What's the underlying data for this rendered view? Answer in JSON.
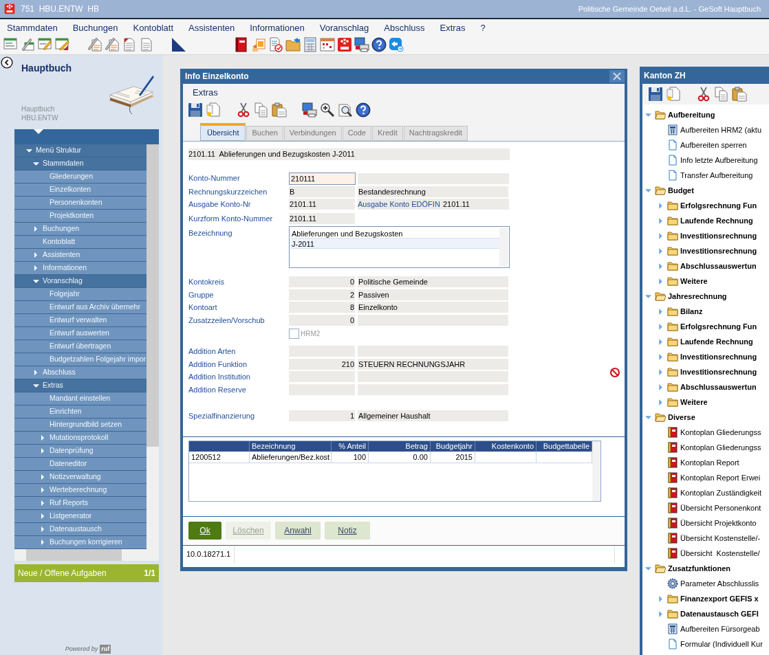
{
  "window": {
    "title": "751  HBU.ENTW  HB",
    "subtitle": "Politische Gemeinde Oetwil a.d.L. - GeSoft Hauptbuch"
  },
  "menu": [
    "Stammdaten",
    "Buchungen",
    "Kontoblatt",
    "Assistenten",
    "Informationen",
    "Voranschlag",
    "Abschluss",
    "Extras",
    "?"
  ],
  "sidebar": {
    "title": "Hauptbuch",
    "caption": [
      "Hauptbuch",
      "HBU.ENTW"
    ],
    "tree": [
      {
        "label": "Menü Struktur",
        "kind": "branch",
        "expanded": true,
        "children": [
          {
            "label": "Stammdaten",
            "kind": "branch",
            "expanded": true,
            "children": [
              {
                "label": "Gliederungen",
                "kind": "leaf"
              },
              {
                "label": "Einzelkonten",
                "kind": "leaf"
              },
              {
                "label": "Personenkonten",
                "kind": "leaf"
              },
              {
                "label": "Projektkonten",
                "kind": "leaf"
              }
            ]
          },
          {
            "label": "Buchungen",
            "kind": "branch",
            "expanded": false
          },
          {
            "label": "Kontoblatt",
            "kind": "leaf"
          },
          {
            "label": "Assistenten",
            "kind": "branch",
            "expanded": false
          },
          {
            "label": "Informationen",
            "kind": "branch",
            "expanded": false
          },
          {
            "label": "Voranschlag",
            "kind": "branch",
            "expanded": true,
            "children": [
              {
                "label": "Folgejahr",
                "kind": "leaf"
              },
              {
                "label": "Entwurf aus Archiv übernehr",
                "kind": "leaf"
              },
              {
                "label": "Entwurf verwalten",
                "kind": "leaf"
              },
              {
                "label": "Entwurf auswerten",
                "kind": "leaf"
              },
              {
                "label": "Entwurf übertragen",
                "kind": "leaf"
              },
              {
                "label": "Budgetzahlen Folgejahr impor",
                "kind": "leaf"
              }
            ]
          },
          {
            "label": "Abschluss",
            "kind": "branch",
            "expanded": false
          },
          {
            "label": "Extras",
            "kind": "branch",
            "expanded": true,
            "children": [
              {
                "label": "Mandant einstellen",
                "kind": "leaf"
              },
              {
                "label": "Einrichten",
                "kind": "leaf"
              },
              {
                "label": "Hintergrundbild setzen",
                "kind": "leaf"
              },
              {
                "label": "Mutationsprotokoll",
                "kind": "branch",
                "expanded": false
              },
              {
                "label": "Datenprüfung",
                "kind": "branch",
                "expanded": false
              },
              {
                "label": "Dateneditor",
                "kind": "leaf"
              },
              {
                "label": "Notizverwaltung",
                "kind": "branch",
                "expanded": false
              },
              {
                "label": "Werteberechnung",
                "kind": "branch",
                "expanded": false
              },
              {
                "label": "Ruf Reports",
                "kind": "branch",
                "expanded": false
              },
              {
                "label": "Listgenerator",
                "kind": "branch",
                "expanded": false
              },
              {
                "label": "Datenaustausch",
                "kind": "branch",
                "expanded": false
              },
              {
                "label": "Buchungen korrigieren",
                "kind": "branch",
                "expanded": false
              }
            ]
          }
        ]
      }
    ],
    "tasks": {
      "label": "Neue / Offene Aufgaben",
      "count": "1/1"
    },
    "footer": {
      "text": "Powered by",
      "logo": "ruf"
    }
  },
  "dialog": {
    "title": "Info Einzelkonto",
    "menu": [
      "Extras"
    ],
    "tabs": [
      {
        "label": "Übersicht",
        "selected": true
      },
      {
        "label": "Buchen",
        "selected": false
      },
      {
        "label": "Verbindungen",
        "selected": false
      },
      {
        "label": "Code",
        "selected": false
      },
      {
        "label": "Kredit",
        "selected": false
      },
      {
        "label": "Nachtragskredit",
        "selected": false
      }
    ],
    "header": "2101.11  Ablieferungen und Bezugskosten J-2011",
    "sections": [
      {
        "rows": [
          {
            "label": "Konto-Nummer",
            "kind": "input",
            "value": "210111"
          },
          {
            "label": "Rechnungskurzzeichen",
            "kind": "pair",
            "code": "B",
            "text": "Bestandesrechnung"
          },
          {
            "label": "Ausgabe Konto-Nr",
            "kind": "dual",
            "code": "2101.11",
            "label_2": "Ausgabe Konto EDÖFIN",
            "value_2": "2101.11"
          }
        ]
      },
      {
        "rows": [
          {
            "label": "Kurzform Konto-Nummer",
            "kind": "single",
            "code": "2101.11"
          },
          {
            "label": "Bezeichnung",
            "kind": "textarea",
            "lines": [
              "Ablieferungen und Bezugskosten",
              "J-2011"
            ]
          }
        ]
      },
      {
        "rows": [
          {
            "label": "Kontokreis",
            "kind": "number",
            "code": "0",
            "text": "Politische Gemeinde"
          },
          {
            "label": "Gruppe",
            "kind": "number",
            "code": "2",
            "text": "Passiven"
          },
          {
            "label": "Kontoart",
            "kind": "number",
            "code": "8",
            "text": "Einzelkonto"
          },
          {
            "label": "Zusatzzeilen/Vorschub",
            "kind": "number",
            "code": "0"
          }
        ]
      },
      {
        "rows": [
          {
            "label": "HRM2",
            "kind": "checkbox",
            "checked": false,
            "disabled": true
          }
        ]
      },
      {
        "status_icon": true,
        "rows": [
          {
            "label": "Addition Arten",
            "kind": "number"
          },
          {
            "label": "Addition Funktion",
            "kind": "number",
            "code": "210",
            "text": "STEUERN RECHNUNGSJAHR"
          },
          {
            "label": "Addition Institution",
            "kind": "number"
          },
          {
            "label": "Addition Reserve",
            "kind": "number"
          }
        ]
      },
      {
        "rows": [
          {
            "label": "Spezialfinanzierung",
            "kind": "number",
            "code": "1",
            "text": "Allgemeiner Haushalt"
          }
        ]
      }
    ],
    "table": {
      "columns": [
        {},
        {
          "label": "Bezeichnung"
        },
        {
          "label": "% Anteil"
        },
        {
          "label": "Betrag"
        },
        {
          "label": "Budgetjahr"
        },
        {
          "label": "Kostenkonto"
        },
        {
          "label": "Budgettabelle"
        }
      ],
      "rows": [
        {
          "cells": [
            "1200512",
            "Ablieferungen/Bez.kost",
            "100",
            "0.00",
            "2015"
          ]
        }
      ]
    },
    "buttons": [
      {
        "label": "Ok",
        "kind": "primary",
        "disabled": false
      },
      {
        "label": "Löschen",
        "kind": "normal",
        "disabled": true
      },
      {
        "label": "Anwahl",
        "kind": "normal",
        "disabled": false
      },
      {
        "label": "Notiz",
        "kind": "normal",
        "disabled": false
      }
    ],
    "status_bar": "10.0.18271.1"
  },
  "panel": {
    "title": "Kanton ZH",
    "tree": [
      {
        "label": "Aufbereitung",
        "kind": "folder",
        "expanded": true,
        "children": [
          {
            "label": "Aufbereiten HRM2 (aktu",
            "kind": "calc"
          },
          {
            "label": "Aufbereiten sperren",
            "kind": "doc"
          },
          {
            "label": "Info letzte Aufbereitung",
            "kind": "doc"
          },
          {
            "label": "Transfer Aufbereitung",
            "kind": "doc"
          }
        ]
      },
      {
        "label": "Budget",
        "kind": "folder",
        "expanded": true,
        "children": [
          {
            "label": "Erfolgsrechnung Fun",
            "kind": "folder",
            "expanded": false
          },
          {
            "label": "Laufende Rechnung",
            "kind": "folder",
            "expanded": false
          },
          {
            "label": "Investitionsrechnung",
            "kind": "folder",
            "expanded": false
          },
          {
            "label": "Investitionsrechnung",
            "kind": "folder",
            "expanded": false
          },
          {
            "label": "Abschlussauswertun",
            "kind": "folder",
            "expanded": false
          },
          {
            "label": "Weitere",
            "kind": "folder",
            "expanded": false
          }
        ]
      },
      {
        "label": "Jahresrechnung",
        "kind": "folder",
        "expanded": true,
        "children": [
          {
            "label": "Bilanz",
            "kind": "folder",
            "expanded": false
          },
          {
            "label": "Erfolgsrechnung Fun",
            "kind": "folder",
            "expanded": false
          },
          {
            "label": "Laufende Rechnung",
            "kind": "folder",
            "expanded": false
          },
          {
            "label": "Investitionsrechnung",
            "kind": "folder",
            "expanded": false
          },
          {
            "label": "Investitionsrechnung",
            "kind": "folder",
            "expanded": false
          },
          {
            "label": "Abschlussauswertun",
            "kind": "folder",
            "expanded": false
          },
          {
            "label": "Weitere",
            "kind": "folder",
            "expanded": false
          }
        ]
      },
      {
        "label": "Diverse",
        "kind": "folder",
        "expanded": true,
        "children": [
          {
            "label": "Kontoplan Gliederungss",
            "kind": "report"
          },
          {
            "label": "Kontoplan Gliederungss",
            "kind": "report"
          },
          {
            "label": "Kontoplan Report",
            "kind": "report"
          },
          {
            "label": "Kontoplan Report Erwei",
            "kind": "report"
          },
          {
            "label": "Kontoplan Zuständigkeit",
            "kind": "report"
          },
          {
            "label": "Übersicht Personenkont",
            "kind": "report"
          },
          {
            "label": "Übersicht Projektkonto",
            "kind": "report"
          },
          {
            "label": "Übersicht Kostenstelle/-",
            "kind": "report"
          },
          {
            "label": "Übersicht  Kostenstelle/",
            "kind": "report"
          }
        ]
      },
      {
        "label": "Zusatzfunktionen",
        "kind": "folder",
        "expanded": true,
        "children": [
          {
            "label": "Parameter Abschlusslis",
            "kind": "gear"
          },
          {
            "label": "Finanzexport GEFIS x",
            "kind": "folder",
            "expanded": false
          },
          {
            "label": "Datenaustausch GEFI",
            "kind": "folder",
            "expanded": false
          },
          {
            "label": "Aufbereiten Fürsorgeab",
            "kind": "calc"
          },
          {
            "label": "Formular (Individuell Kur",
            "kind": "doc"
          }
        ]
      }
    ]
  }
}
